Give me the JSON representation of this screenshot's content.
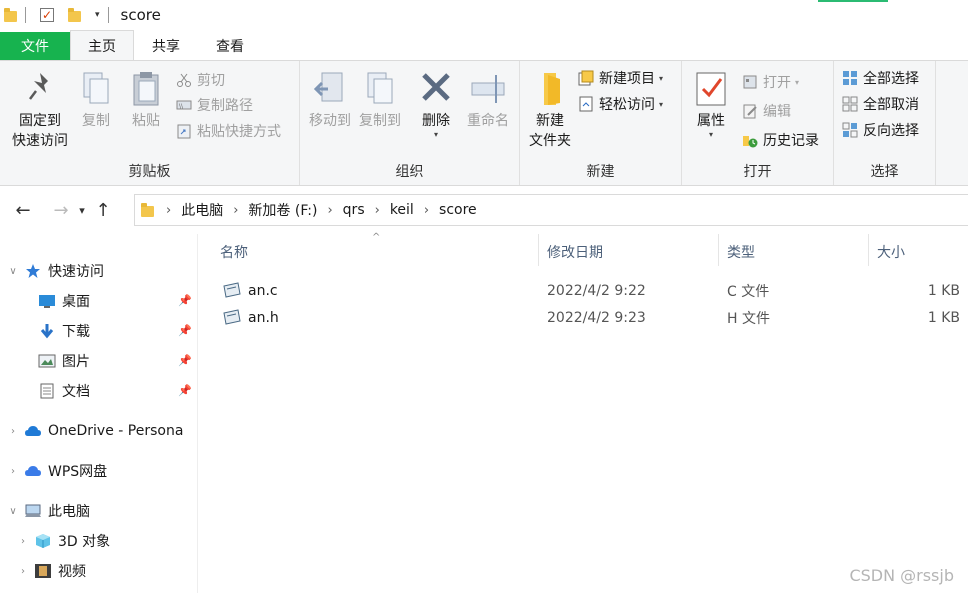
{
  "window": {
    "title": "score"
  },
  "ribbon_tabs": [
    {
      "label": "文件"
    },
    {
      "label": "主页"
    },
    {
      "label": "共享"
    },
    {
      "label": "查看"
    }
  ],
  "ribbon": {
    "clipboard": {
      "title": "剪贴板",
      "pin_label_1": "固定到",
      "pin_label_2": "快速访问",
      "copy": "复制",
      "paste": "粘贴",
      "cut": "剪切",
      "copy_path": "复制路径",
      "paste_shortcut": "粘贴快捷方式"
    },
    "organize": {
      "title": "组织",
      "move_to": "移动到",
      "copy_to": "复制到",
      "delete": "删除",
      "rename": "重命名"
    },
    "new": {
      "title": "新建",
      "new_folder_1": "新建",
      "new_folder_2": "文件夹",
      "new_item": "新建项目",
      "easy_access": "轻松访问"
    },
    "open": {
      "title": "打开",
      "properties": "属性",
      "open": "打开",
      "edit": "编辑",
      "history": "历史记录"
    },
    "select": {
      "title": "选择",
      "select_all": "全部选择",
      "select_none": "全部取消",
      "invert": "反向选择"
    }
  },
  "breadcrumb": [
    "此电脑",
    "新加卷 (F:)",
    "qrs",
    "keil",
    "score"
  ],
  "nav_pane": {
    "quick_access": "快速访问",
    "desktop": "桌面",
    "downloads": "下载",
    "pictures": "图片",
    "documents": "文档",
    "onedrive": "OneDrive - Persona",
    "wps": "WPS网盘",
    "this_pc": "此电脑",
    "objects3d": "3D 对象",
    "videos": "视频"
  },
  "columns": {
    "name": "名称",
    "modified": "修改日期",
    "type": "类型",
    "size": "大小"
  },
  "files": [
    {
      "name": "an.c",
      "modified": "2022/4/2 9:22",
      "type": "C 文件",
      "size": "1 KB"
    },
    {
      "name": "an.h",
      "modified": "2022/4/2 9:23",
      "type": "H 文件",
      "size": "1 KB"
    }
  ],
  "watermark": "CSDN @rssjb",
  "colors": {
    "file_tab": "#17b34f",
    "accent": "#2bbb73",
    "header_text": "#4c607a"
  }
}
